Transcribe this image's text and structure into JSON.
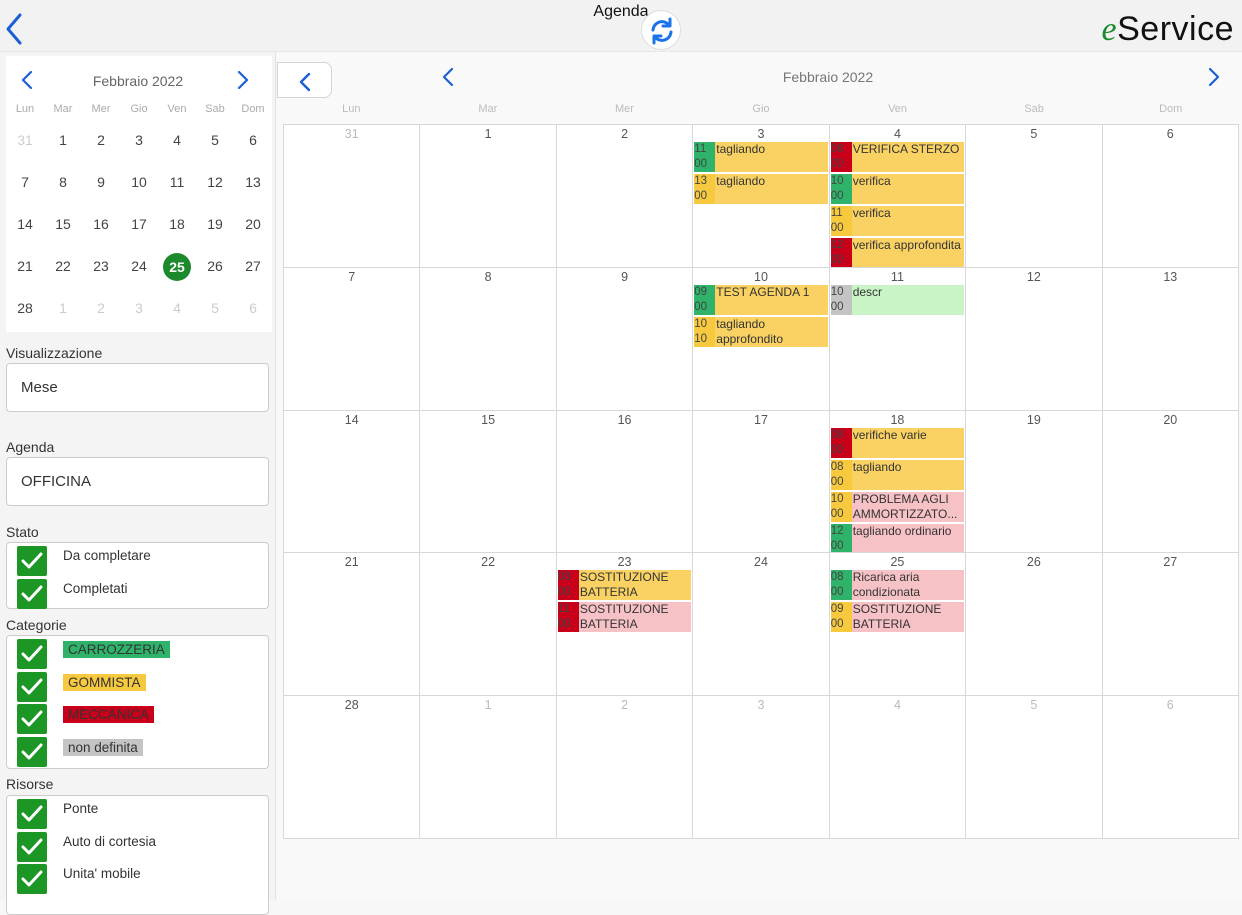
{
  "header": {
    "title": "Agenda",
    "logo_prefix": "e",
    "logo_rest": "Service"
  },
  "mini_calendar": {
    "month": "Febbraio 2022",
    "weekdays": [
      "Lun",
      "Mar",
      "Mer",
      "Gio",
      "Ven",
      "Sab",
      "Dom"
    ],
    "days": [
      {
        "n": "31",
        "muted": true
      },
      {
        "n": "1"
      },
      {
        "n": "2"
      },
      {
        "n": "3"
      },
      {
        "n": "4"
      },
      {
        "n": "5"
      },
      {
        "n": "6"
      },
      {
        "n": "7"
      },
      {
        "n": "8"
      },
      {
        "n": "9"
      },
      {
        "n": "10"
      },
      {
        "n": "11"
      },
      {
        "n": "12"
      },
      {
        "n": "13"
      },
      {
        "n": "14"
      },
      {
        "n": "15"
      },
      {
        "n": "16"
      },
      {
        "n": "17"
      },
      {
        "n": "18"
      },
      {
        "n": "19"
      },
      {
        "n": "20"
      },
      {
        "n": "21"
      },
      {
        "n": "22"
      },
      {
        "n": "23"
      },
      {
        "n": "24"
      },
      {
        "n": "25",
        "selected": true
      },
      {
        "n": "26"
      },
      {
        "n": "27"
      },
      {
        "n": "28"
      },
      {
        "n": "1",
        "muted": true
      },
      {
        "n": "2",
        "muted": true
      },
      {
        "n": "3",
        "muted": true
      },
      {
        "n": "4",
        "muted": true
      },
      {
        "n": "5",
        "muted": true
      },
      {
        "n": "6",
        "muted": true
      }
    ]
  },
  "filters": {
    "view_label": "Visualizzazione",
    "view_value": "Mese",
    "agenda_label": "Agenda",
    "agenda_value": "OFFICINA",
    "status_label": "Stato",
    "status_items": [
      "Da completare",
      "Completati"
    ],
    "categories_label": "Categorie",
    "categories": [
      {
        "label": "CARROZZERIA",
        "color": "#2fb36a"
      },
      {
        "label": "GOMMISTA",
        "color": "#f7c93f"
      },
      {
        "label": "MECCANICA",
        "color": "#c8001a"
      },
      {
        "label": "non definita",
        "color": "#c4c4c4"
      }
    ],
    "resources_label": "Risorse",
    "resources": [
      "Ponte",
      "Auto di cortesia",
      "Unita' mobile"
    ]
  },
  "calendar": {
    "month": "Febbraio 2022",
    "weekdays": [
      "Lun",
      "Mar",
      "Mer",
      "Gio",
      "Ven",
      "Sab",
      "Dom"
    ],
    "weeks": [
      [
        {
          "d": "31",
          "muted": true,
          "events": []
        },
        {
          "d": "1",
          "events": []
        },
        {
          "d": "2",
          "events": []
        },
        {
          "d": "3",
          "events": [
            {
              "time": "11 00",
              "title": "tagliando",
              "cat": "#2fb36a",
              "bg": "#f9d263"
            },
            {
              "time": "13 00",
              "title": "tagliando",
              "cat": "#f7c93f",
              "bg": "#f9d263"
            }
          ]
        },
        {
          "d": "4",
          "events": [
            {
              "time": "08 00",
              "title": "VERIFICA STERZO",
              "cat": "#c8001a",
              "bg": "#f9d263"
            },
            {
              "time": "10 00",
              "title": "verifica",
              "cat": "#2fb36a",
              "bg": "#f9d263"
            },
            {
              "time": "11 00",
              "title": "verifica",
              "cat": "#f7c93f",
              "bg": "#f9d263"
            },
            {
              "time": "12 00",
              "title": "verifica approfondita",
              "cat": "#c8001a",
              "bg": "#f9d263"
            }
          ]
        },
        {
          "d": "5",
          "events": []
        },
        {
          "d": "6",
          "events": []
        }
      ],
      [
        {
          "d": "7",
          "events": []
        },
        {
          "d": "8",
          "events": []
        },
        {
          "d": "9",
          "events": []
        },
        {
          "d": "10",
          "events": [
            {
              "time": "09 00",
              "title": "TEST AGENDA 1",
              "cat": "#2fb36a",
              "bg": "#f9d263"
            },
            {
              "time": "10 10",
              "title": "tagliando approfondito",
              "cat": "#f7c93f",
              "bg": "#f9d263"
            }
          ]
        },
        {
          "d": "11",
          "events": [
            {
              "time": "10 00",
              "title": "descr",
              "cat": "#c4c4c4",
              "bg": "#c9f5c6"
            }
          ]
        },
        {
          "d": "12",
          "events": []
        },
        {
          "d": "13",
          "events": []
        }
      ],
      [
        {
          "d": "14",
          "events": []
        },
        {
          "d": "15",
          "events": []
        },
        {
          "d": "16",
          "events": []
        },
        {
          "d": "17",
          "events": []
        },
        {
          "d": "18",
          "events": [
            {
              "time": "08 00",
              "title": "verifiche varie",
              "cat": "#c8001a",
              "bg": "#f9d263"
            },
            {
              "time": "08 00",
              "title": "tagliando",
              "cat": "#f7c93f",
              "bg": "#f9d263"
            },
            {
              "time": "10 00",
              "title": "PROBLEMA AGLI AMMORTIZZATO...",
              "cat": "#f7c93f",
              "bg": "#f7c2c6"
            },
            {
              "time": "12 00",
              "title": "tagliando ordinario",
              "cat": "#2fb36a",
              "bg": "#f7c2c6"
            }
          ]
        },
        {
          "d": "19",
          "events": []
        },
        {
          "d": "20",
          "events": []
        }
      ],
      [
        {
          "d": "21",
          "events": []
        },
        {
          "d": "22",
          "events": []
        },
        {
          "d": "23",
          "events": [
            {
              "time": "08 00",
              "title": "SOSTITUZIONE BATTERIA",
              "cat": "#c8001a",
              "bg": "#f9d263"
            },
            {
              "time": "11 00",
              "title": "SOSTITUZIONE BATTERIA",
              "cat": "#c8001a",
              "bg": "#f7c2c6"
            }
          ]
        },
        {
          "d": "24",
          "events": []
        },
        {
          "d": "25",
          "events": [
            {
              "time": "08 00",
              "title": "Ricarica aria condizionata",
              "cat": "#2fb36a",
              "bg": "#f7c2c6"
            },
            {
              "time": "09 00",
              "title": "SOSTITUZIONE BATTERIA",
              "cat": "#f7c93f",
              "bg": "#f7c2c6"
            }
          ]
        },
        {
          "d": "26",
          "events": []
        },
        {
          "d": "27",
          "events": []
        }
      ],
      [
        {
          "d": "28",
          "events": []
        },
        {
          "d": "1",
          "muted": true,
          "events": []
        },
        {
          "d": "2",
          "muted": true,
          "events": []
        },
        {
          "d": "3",
          "muted": true,
          "events": []
        },
        {
          "d": "4",
          "muted": true,
          "events": []
        },
        {
          "d": "5",
          "muted": true,
          "events": []
        },
        {
          "d": "6",
          "muted": true,
          "events": []
        }
      ]
    ]
  },
  "colors": {
    "accent": "#1a5fd6",
    "selected": "#1c8a2c",
    "checkbox": "#1c9625"
  }
}
